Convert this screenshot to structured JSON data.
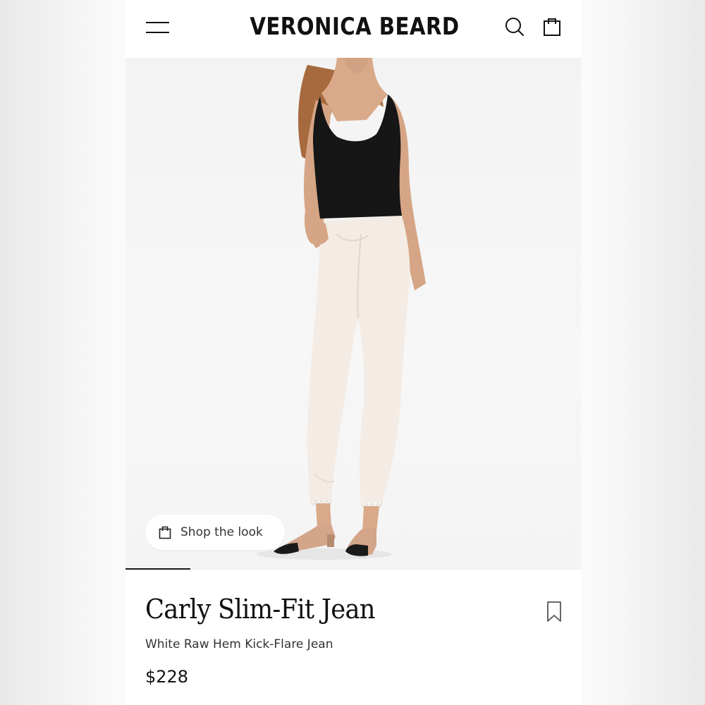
{
  "header": {
    "brand": "VERONICA BEARD",
    "menu_icon": "hamburger-menu-icon",
    "search_icon": "search-icon",
    "bag_icon": "shopping-bag-icon"
  },
  "hero": {
    "shop_look_label": "Shop the look",
    "shop_look_icon": "shopping-bag-icon",
    "carousel_progress": 0.143
  },
  "product": {
    "name": "Carly Slim-Fit Jean",
    "subtitle": "White Raw Hem Kick-Flare Jean",
    "price": "$228",
    "bookmark_icon": "bookmark-icon"
  },
  "colors": {
    "accent": "#111111",
    "top": "#161616",
    "jeans": "#f4ebe4",
    "skin": "#d9a989",
    "hair": "#a76a3f",
    "shoe": "#d3a589"
  }
}
